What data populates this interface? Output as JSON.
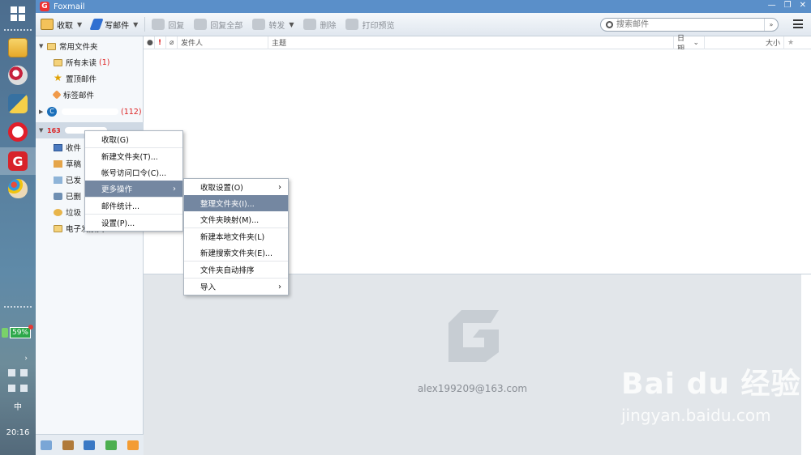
{
  "app": {
    "title": "Foxmail"
  },
  "taskbar": {
    "battery": "59%",
    "ime": "中",
    "clock": "20:16",
    "apps": [
      "explorer-icon",
      "paint-icon",
      "python-icon",
      "opera-icon",
      "foxmail-icon",
      "palette-icon"
    ]
  },
  "toolbar": {
    "receive": "收取",
    "compose": "写邮件",
    "reply": "回复",
    "reply_all": "回复全部",
    "forward": "转发",
    "delete": "删除",
    "print_preview": "打印预览",
    "search_placeholder": "搜索邮件"
  },
  "folders": {
    "common_group": "常用文件夹",
    "all_unread": "所有未读",
    "all_unread_count": "(1)",
    "pinned": "置顶邮件",
    "tagged": "标签邮件",
    "account1_count": "(112)",
    "account2_prefix": "163",
    "inbox": "收件",
    "drafts": "草稿",
    "sent": "已发",
    "deleted": "已删",
    "junk": "垃圾",
    "ebill": "电子发票夹"
  },
  "list_header": {
    "sender": "发件人",
    "subject": "主题",
    "date": "日期",
    "size": "大小"
  },
  "preview": {
    "email": "alex199209@163.com"
  },
  "context_menu": {
    "items": [
      "收取(G)",
      "新建文件夹(T)...",
      "帐号访问口令(C)...",
      "更多操作",
      "邮件统计...",
      "设置(P)..."
    ]
  },
  "submenu": {
    "items": [
      "收取设置(O)",
      "整理文件夹(I)...",
      "文件夹映射(M)...",
      "新建本地文件夹(L)",
      "新建搜索文件夹(E)...",
      "文件夹自动排序",
      "导入"
    ]
  },
  "watermark": {
    "big": "Bai du 经验",
    "small": "jingyan.baidu.com"
  },
  "colors": {
    "accent": "#5a8fc9",
    "highlight": "#7487a1",
    "count": "#dd2222"
  }
}
